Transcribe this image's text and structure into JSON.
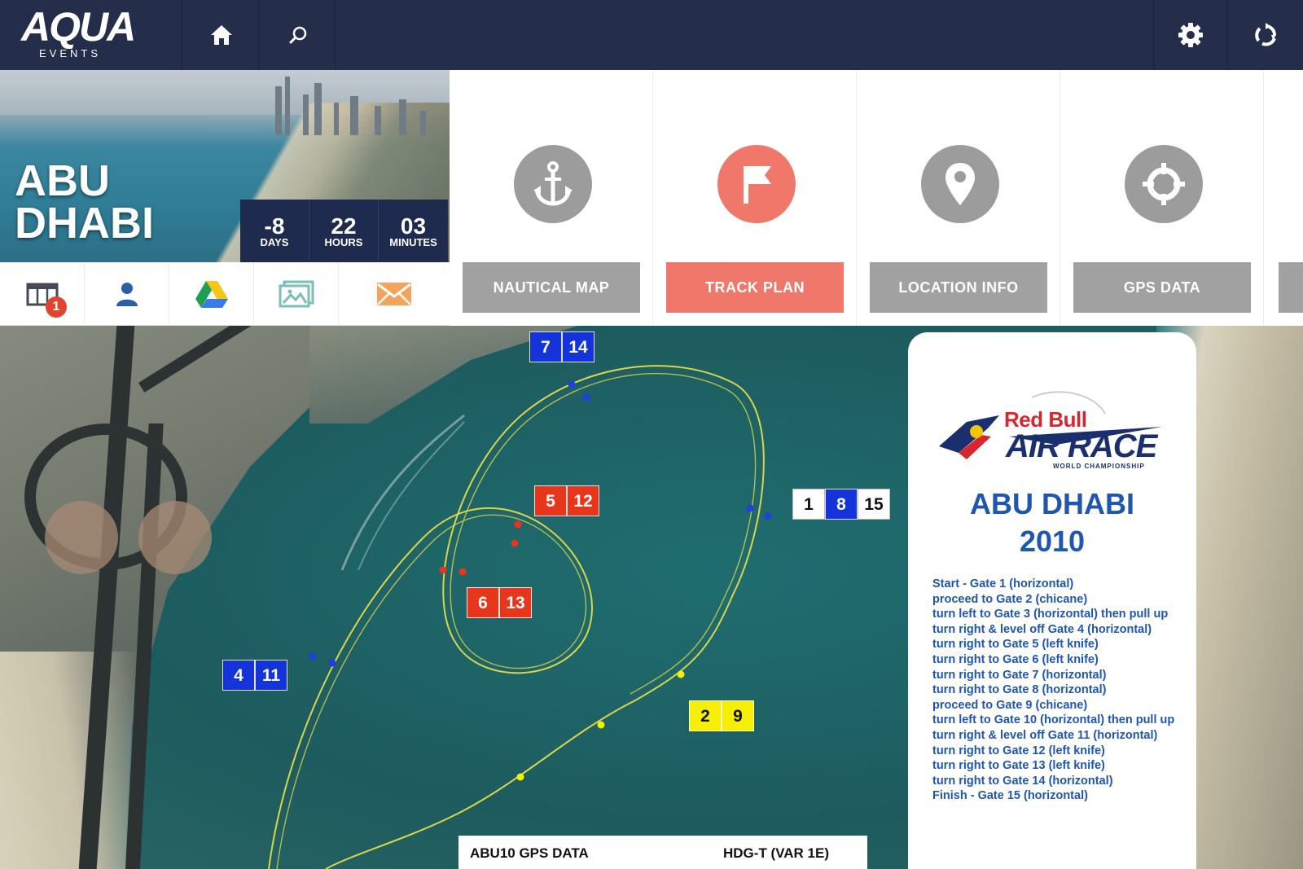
{
  "app": {
    "logo_text": "AQUA",
    "logo_subtext": "EVENTS"
  },
  "topbar": {
    "icons": [
      "home-icon",
      "search-icon",
      "gear-icon",
      "sync-icon"
    ]
  },
  "hero": {
    "title_line1": "ABU",
    "title_line2": "DHABI",
    "countdown": [
      {
        "value": "-8",
        "unit": "DAYS"
      },
      {
        "value": "22",
        "unit": "HOURS"
      },
      {
        "value": "03",
        "unit": "MINUTES"
      }
    ]
  },
  "quick_actions": {
    "calendar_badge": "1",
    "icons": [
      "calendar-icon",
      "user-icon",
      "google-drive-icon",
      "gallery-icon",
      "mail-icon"
    ]
  },
  "tiles": [
    {
      "label": "NAUTICAL MAP",
      "icon": "anchor-icon",
      "active": false
    },
    {
      "label": "TRACK PLAN",
      "icon": "flag-icon",
      "active": true
    },
    {
      "label": "LOCATION INFO",
      "icon": "location-pin-icon",
      "active": false
    },
    {
      "label": "GPS DATA",
      "icon": "crosshair-icon",
      "active": false
    }
  ],
  "colors": {
    "topbar": "#242d49",
    "countdown_bg": "#1e2a4e",
    "active_tile": "#f0786a",
    "inactive_tile": "#a1a1a1",
    "gate_blue": "#1433d9",
    "gate_red": "#e8361d",
    "gate_yellow": "#f6ef00",
    "card_text": "#1f56b0"
  },
  "map": {
    "gates": [
      {
        "numbers": [
          "7",
          "14"
        ],
        "color": "blue"
      },
      {
        "numbers": [
          "5",
          "12"
        ],
        "color": "red"
      },
      {
        "numbers": [
          "1",
          "8",
          "15"
        ],
        "color": [
          "white",
          "blue",
          "white"
        ]
      },
      {
        "numbers": [
          "6",
          "13"
        ],
        "color": "red"
      },
      {
        "numbers": [
          "4",
          "11"
        ],
        "color": "blue"
      },
      {
        "numbers": [
          "2",
          "9"
        ],
        "color": "yellow"
      }
    ]
  },
  "card": {
    "brand": "Red Bull",
    "race": "AIR RACE",
    "subtitle": "WORLD CHAMPIONSHIP",
    "title_line1": "ABU DHABI",
    "title_line2": "2010",
    "steps": [
      "Start - Gate 1 (horizontal)",
      "proceed to Gate 2 (chicane)",
      "turn left to Gate 3 (horizontal) then pull up",
      "turn right & level off Gate 4 (horizontal)",
      "turn right to Gate 5 (left knife)",
      "turn right to Gate 6 (left knife)",
      "turn right to Gate 7 (horizontal)",
      "turn right to Gate 8 (horizontal)",
      "proceed to Gate 9 (chicane)",
      "turn left to Gate 10 (horizontal) then pull up",
      "turn right & level off Gate 11 (horizontal)",
      "turn right to Gate 12 (left knife)",
      "turn right to Gate 13 (left knife)",
      "turn right to Gate 14 (horizontal)",
      "Finish - Gate 15 (horizontal)"
    ]
  },
  "gps_panel": {
    "title": "ABU10 GPS DATA",
    "heading": "HDG-T (VAR 1E)"
  }
}
